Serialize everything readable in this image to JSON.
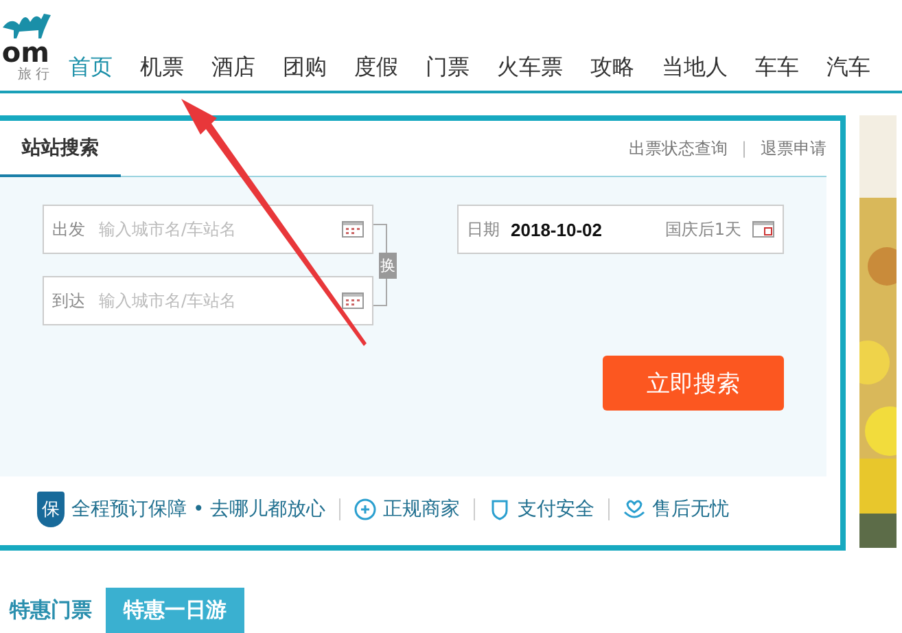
{
  "logo": {
    "text": "om",
    "subtitle": "旅 行"
  },
  "nav": [
    {
      "label": "首页",
      "selected": true
    },
    {
      "label": "机票",
      "selected": false
    },
    {
      "label": "酒店",
      "selected": false
    },
    {
      "label": "团购",
      "selected": false
    },
    {
      "label": "度假",
      "selected": false
    },
    {
      "label": "门票",
      "selected": false
    },
    {
      "label": "火车票",
      "selected": false
    },
    {
      "label": "攻略",
      "selected": false
    },
    {
      "label": "当地人",
      "selected": false
    },
    {
      "label": "车车",
      "selected": false
    },
    {
      "label": "汽车",
      "selected": false
    }
  ],
  "search_panel": {
    "tabs": [
      {
        "label": "站站搜索",
        "selected": true
      }
    ],
    "links": [
      "出票状态查询",
      "退票申请"
    ],
    "links_separator": "|",
    "from": {
      "label": "出发",
      "placeholder": "输入城市名/车站名"
    },
    "to": {
      "label": "到达",
      "placeholder": "输入城市名/车站名"
    },
    "swap": "换",
    "date": {
      "label": "日期",
      "value": "2018-10-02",
      "note": "国庆后1天"
    },
    "search_button": "立即搜索",
    "guarantees": [
      {
        "kind": "main",
        "badge": "保",
        "text": "全程预订保障 • 去哪儿都放心"
      },
      {
        "kind": "merchant",
        "text": "正规商家"
      },
      {
        "kind": "payment",
        "text": "支付安全"
      },
      {
        "kind": "aftersale",
        "text": "售后无忧"
      }
    ]
  },
  "bottom_tabs": [
    {
      "label": "特惠门票",
      "selected": false
    },
    {
      "label": "特惠一日游",
      "selected": true
    }
  ]
}
